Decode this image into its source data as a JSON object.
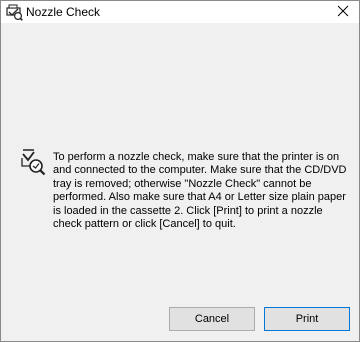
{
  "window": {
    "title": "Nozzle Check",
    "app_icon": "printer-nozzle-icon",
    "close_icon": "close-icon"
  },
  "content": {
    "icon": "nozzle-check-icon",
    "message": "To perform a nozzle check, make sure that the printer is on and connected to the computer. Make sure that the CD/DVD tray is removed; otherwise \"Nozzle Check\" cannot be performed. Also make sure that A4 or Letter size plain paper is loaded in the cassette 2. Click [Print] to print a nozzle check pattern or click [Cancel] to quit."
  },
  "buttons": {
    "cancel_label": "Cancel",
    "print_label": "Print"
  },
  "colors": {
    "dialog_background": "#f0f0f0",
    "titlebar_background": "#ffffff",
    "button_face": "#e1e1e1",
    "default_button_border": "#0078d7"
  }
}
